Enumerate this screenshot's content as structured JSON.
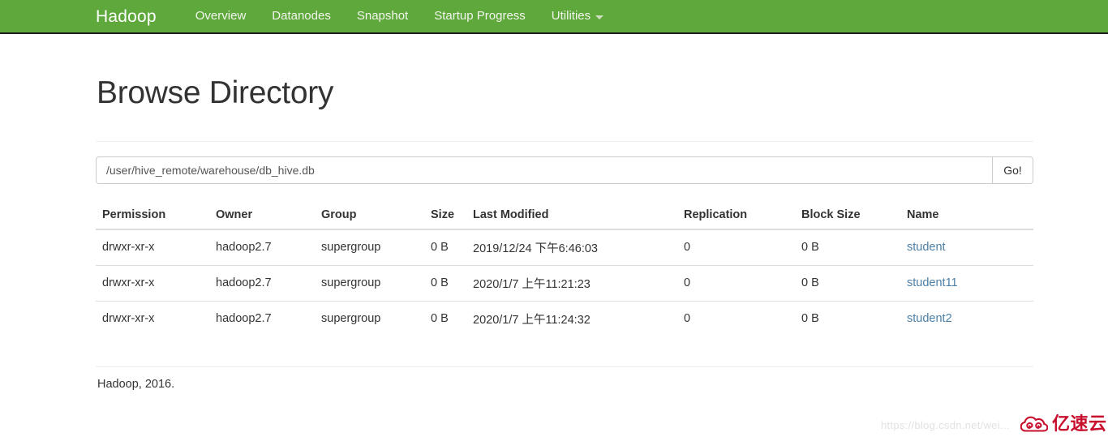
{
  "navbar": {
    "brand": "Hadoop",
    "items": [
      {
        "label": "Overview",
        "dropdown": false
      },
      {
        "label": "Datanodes",
        "dropdown": false
      },
      {
        "label": "Snapshot",
        "dropdown": false
      },
      {
        "label": "Startup Progress",
        "dropdown": false
      },
      {
        "label": "Utilities",
        "dropdown": true
      }
    ],
    "background_color": "#5FA83C",
    "text_color": "#f2f6ef"
  },
  "main": {
    "title": "Browse Directory",
    "path_input": {
      "value": "/user/hive_remote/warehouse/db_hive.db",
      "placeholder": "Enter path"
    },
    "go_button": "Go!",
    "table": {
      "headers": [
        "Permission",
        "Owner",
        "Group",
        "Size",
        "Last Modified",
        "Replication",
        "Block Size",
        "Name"
      ],
      "rows": [
        {
          "permission": "drwxr-xr-x",
          "owner": "hadoop2.7",
          "group": "supergroup",
          "size": "0 B",
          "last_modified": "2019/12/24 下午6:46:03",
          "replication": "0",
          "block_size": "0 B",
          "name": "student"
        },
        {
          "permission": "drwxr-xr-x",
          "owner": "hadoop2.7",
          "group": "supergroup",
          "size": "0 B",
          "last_modified": "2020/1/7 上午11:21:23",
          "replication": "0",
          "block_size": "0 B",
          "name": "student11"
        },
        {
          "permission": "drwxr-xr-x",
          "owner": "hadoop2.7",
          "group": "supergroup",
          "size": "0 B",
          "last_modified": "2020/1/7 上午11:24:32",
          "replication": "0",
          "block_size": "0 B",
          "name": "student2"
        }
      ]
    }
  },
  "footer": {
    "text": "Hadoop, 2016."
  },
  "watermarks": {
    "csdn": "https://blog.csdn.net/wei...",
    "logo_text": "亿速云",
    "logo_color": "#c8102e"
  }
}
